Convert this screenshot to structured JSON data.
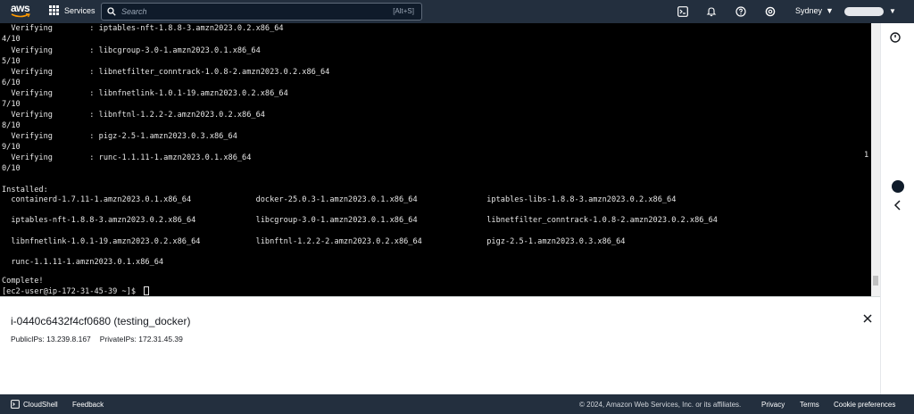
{
  "nav": {
    "logo_text": "aws",
    "services_label": "Services",
    "search_placeholder": "Search",
    "search_shortcut": "[Alt+S]",
    "region_label": "Sydney",
    "icons": [
      "cloudshell-icon",
      "bell-icon",
      "help-icon",
      "gear-icon"
    ]
  },
  "terminal": {
    "lines": [
      "  Verifying        : iptables-nft-1.8.8-3.amzn2023.0.2.x86_64",
      "4/10",
      "  Verifying        : libcgroup-3.0-1.amzn2023.0.1.x86_64",
      "5/10",
      "  Verifying        : libnetfilter_conntrack-1.0.8-2.amzn2023.0.2.x86_64",
      "6/10",
      "  Verifying        : libnfnetlink-1.0.1-19.amzn2023.0.2.x86_64",
      "7/10",
      "  Verifying        : libnftnl-1.2.2-2.amzn2023.0.2.x86_64",
      "8/10",
      "  Verifying        : pigz-2.5-1.amzn2023.0.3.x86_64",
      "9/10",
      "  Verifying        : runc-1.1.11-1.amzn2023.0.1.x86_64",
      "0/10",
      "",
      "Installed:",
      "  containerd-1.7.11-1.amzn2023.0.1.x86_64              docker-25.0.3-1.amzn2023.0.1.x86_64               iptables-libs-1.8.8-3.amzn2023.0.2.x86_64",
      "",
      "  iptables-nft-1.8.8-3.amzn2023.0.2.x86_64             libcgroup-3.0-1.amzn2023.0.1.x86_64               libnetfilter_conntrack-1.0.8-2.amzn2023.0.2.x86_64",
      "",
      "  libnfnetlink-1.0.1-19.amzn2023.0.2.x86_64            libnftnl-1.2.2-2.amzn2023.0.2.x86_64              pigz-2.5-1.amzn2023.0.3.x86_64",
      "",
      "  runc-1.1.11-1.amzn2023.0.1.x86_64",
      "",
      "Complete!",
      "[ec2-user@ip-172-31-45-39 ~]$ "
    ],
    "overflow_char": "1"
  },
  "instance": {
    "title": "i-0440c6432f4cf0680 (testing_docker)",
    "public_ips": "PublicIPs: 13.239.8.167",
    "private_ips": "PrivateIPs: 172.31.45.39"
  },
  "footer": {
    "cloudshell_label": "CloudShell",
    "feedback_label": "Feedback",
    "copyright": "© 2024, Amazon Web Services, Inc. or its affiliates.",
    "privacy_label": "Privacy",
    "terms_label": "Terms",
    "cookies_label": "Cookie preferences"
  },
  "colors": {
    "nav_bg": "#232f3e",
    "terminal_bg": "#000000",
    "terminal_text": "#e6e6e6",
    "accent_orange": "#ff9900"
  }
}
